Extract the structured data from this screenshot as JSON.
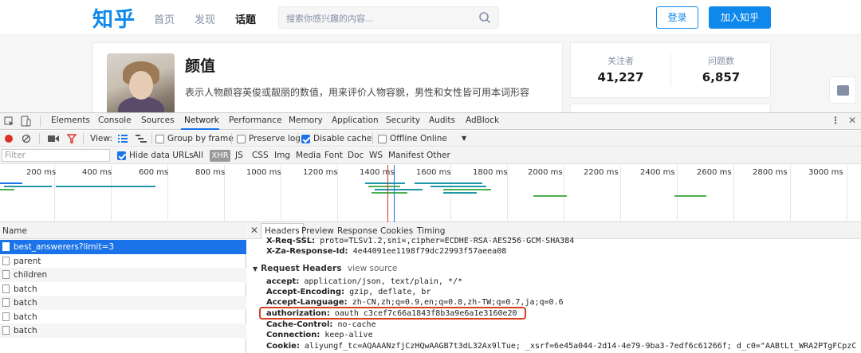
{
  "zhihu": {
    "logo": "知乎",
    "nav": [
      "首页",
      "发现",
      "话题"
    ],
    "search_placeholder": "搜索你感兴趣的内容...",
    "login_label": "登录",
    "join_label": "加入知乎",
    "topic": {
      "title": "颜值",
      "description": "表示人物颜容英俊或靓丽的数值，用来评价人物容貌，男性和女性皆可用本词形容"
    },
    "stats": [
      {
        "label": "关注者",
        "value": "41,227"
      },
      {
        "label": "问题数",
        "value": "6,857"
      }
    ]
  },
  "devtools": {
    "tabs": [
      "Elements",
      "Console",
      "Sources",
      "Network",
      "Performance",
      "Memory",
      "Application",
      "Security",
      "Audits",
      "AdBlock"
    ],
    "active_tab": "Network",
    "toolbar": {
      "view_label": "View:",
      "group_by_frame": "Group by frame",
      "preserve_log": "Preserve log",
      "disable_cache": "Disable cache",
      "offline": "Offline",
      "throttle": "Online"
    },
    "filter": {
      "placeholder": "Filter",
      "hide_data_urls": "Hide data URLs",
      "types": [
        "All",
        "XHR",
        "JS",
        "CSS",
        "Img",
        "Media",
        "Font",
        "Doc",
        "WS",
        "Manifest",
        "Other"
      ],
      "active_type": "XHR"
    },
    "timeline_labels": [
      "200 ms",
      "400 ms",
      "600 ms",
      "800 ms",
      "1000 ms",
      "1200 ms",
      "1400 ms",
      "1600 ms",
      "1800 ms",
      "2000 ms",
      "2200 ms",
      "2400 ms",
      "2600 ms",
      "2800 ms",
      "3000 ms"
    ],
    "name_header": "Name",
    "requests": [
      "best_answerers?limit=3",
      "parent",
      "children",
      "batch",
      "batch",
      "batch",
      "batch"
    ],
    "detail_tabs": [
      "Headers",
      "Preview",
      "Response",
      "Cookies",
      "Timing"
    ],
    "response_headers_partial": [
      {
        "key": "X-Req-SSL:",
        "value": "proto=TLSv1.2,sni=,cipher=ECDHE-RSA-AES256-GCM-SHA384"
      },
      {
        "key": "X-Za-Response-Id:",
        "value": "4e44091ee1198f79dc22993f57aeea08"
      }
    ],
    "request_headers_title": "Request Headers",
    "view_source": "view source",
    "request_headers": [
      {
        "key": "accept:",
        "value": "application/json, text/plain, */*"
      },
      {
        "key": "Accept-Encoding:",
        "value": "gzip, deflate, br"
      },
      {
        "key": "Accept-Language:",
        "value": "zh-CN,zh;q=0.9,en;q=0.8,zh-TW;q=0.7,ja;q=0.6"
      },
      {
        "key": "authorization:",
        "value": "oauth c3cef7c66a1843f8b3a9e6a1e3160e20"
      },
      {
        "key": "Cache-Control:",
        "value": "no-cache"
      },
      {
        "key": "Connection:",
        "value": "keep-alive"
      },
      {
        "key": "Cookie:",
        "value": "aliyungf_tc=AQAAANzfjCzHQwAAGB7t3dL32Ax9lTue; _xsrf=6e45a044-2d14-4e79-9ba3-7edf6c61266f; d_c0=\"AABtLt_WRA2PTgFCpzC"
      }
    ],
    "highlight_color": "#d9401f",
    "accent_color": "#1a73e8"
  }
}
